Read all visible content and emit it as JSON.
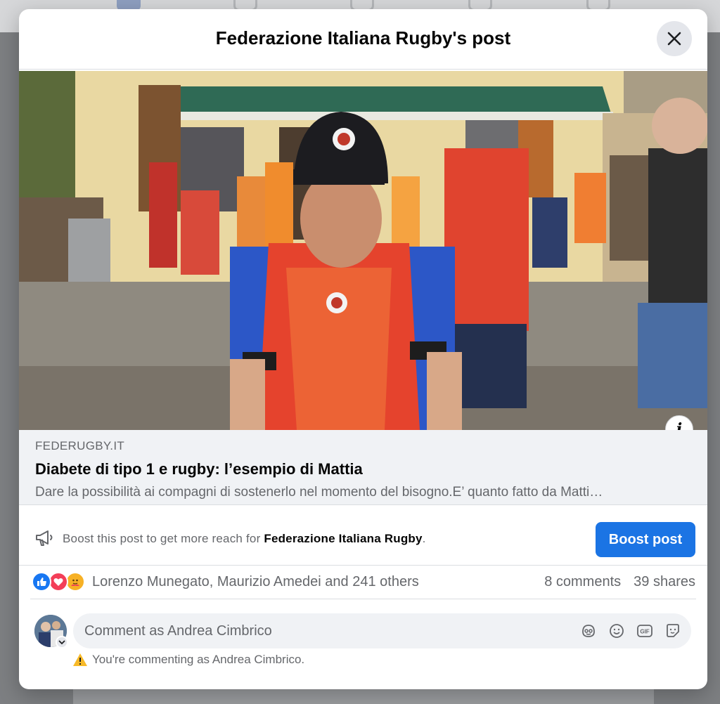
{
  "modal": {
    "title": "Federazione Italiana Rugby's post"
  },
  "link_preview": {
    "domain": "FEDERUGBY.IT",
    "title": "Diabete di tipo 1 e rugby: l’esempio di Mattia",
    "description": "Dare la possibilità ai compagni di sostenerlo nel momento del bisogno.E’ quanto fatto da Matti…",
    "info_symbol": "i"
  },
  "boost": {
    "text_prefix": "Boost this post to get more reach for ",
    "page_name": "Federazione Italiana Rugby",
    "text_suffix": ".",
    "button_label": "Boost post"
  },
  "reactions": {
    "icons": [
      "like-icon",
      "love-icon",
      "care-icon"
    ],
    "names": "Lorenzo Munegato, Maurizio Amedei and 241 others",
    "comments": "8 comments",
    "shares": "39 shares"
  },
  "composer": {
    "placeholder": "Comment as Andrea Cimbrico",
    "icons": [
      "avatar-sticker-icon",
      "emoji-icon",
      "gif-icon",
      "sticker-icon"
    ],
    "gif_label": "GIF",
    "warning": "You're commenting as Andrea Cimbrico."
  },
  "colors": {
    "accent": "#1b74e4",
    "like": "#1877f2",
    "love": "#f33e58",
    "care": "#f7b125",
    "warning": "#f7b928"
  }
}
